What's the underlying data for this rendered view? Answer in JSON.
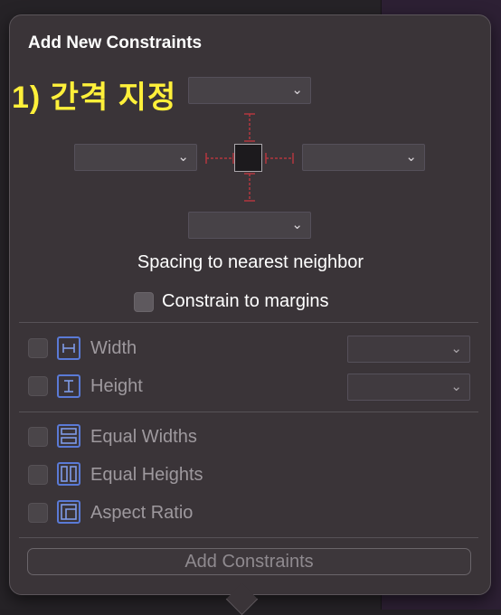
{
  "popover": {
    "title": "Add New Constraints",
    "annotation": "1) 간격 지정",
    "spacing_label": "Spacing to nearest neighbor",
    "constrain_margins_label": "Constrain to margins",
    "constrain_margins_checked": false
  },
  "spacing_fields": {
    "top": {
      "value": ""
    },
    "left": {
      "value": ""
    },
    "right": {
      "value": ""
    },
    "bottom": {
      "value": ""
    }
  },
  "size_rows": [
    {
      "label": "Width",
      "icon": "width-icon",
      "checked": false,
      "value": ""
    },
    {
      "label": "Height",
      "icon": "height-icon",
      "checked": false,
      "value": ""
    }
  ],
  "equal_rows": [
    {
      "label": "Equal Widths",
      "icon": "equal-widths-icon",
      "checked": false
    },
    {
      "label": "Equal Heights",
      "icon": "equal-heights-icon",
      "checked": false
    },
    {
      "label": "Aspect Ratio",
      "icon": "aspect-ratio-icon",
      "checked": false
    }
  ],
  "add_button": {
    "label": "Add Constraints",
    "enabled": false
  },
  "colors": {
    "annotation": "#fff03a",
    "icon_accent": "#5a7ad6",
    "guide_red": "#b3373f"
  }
}
